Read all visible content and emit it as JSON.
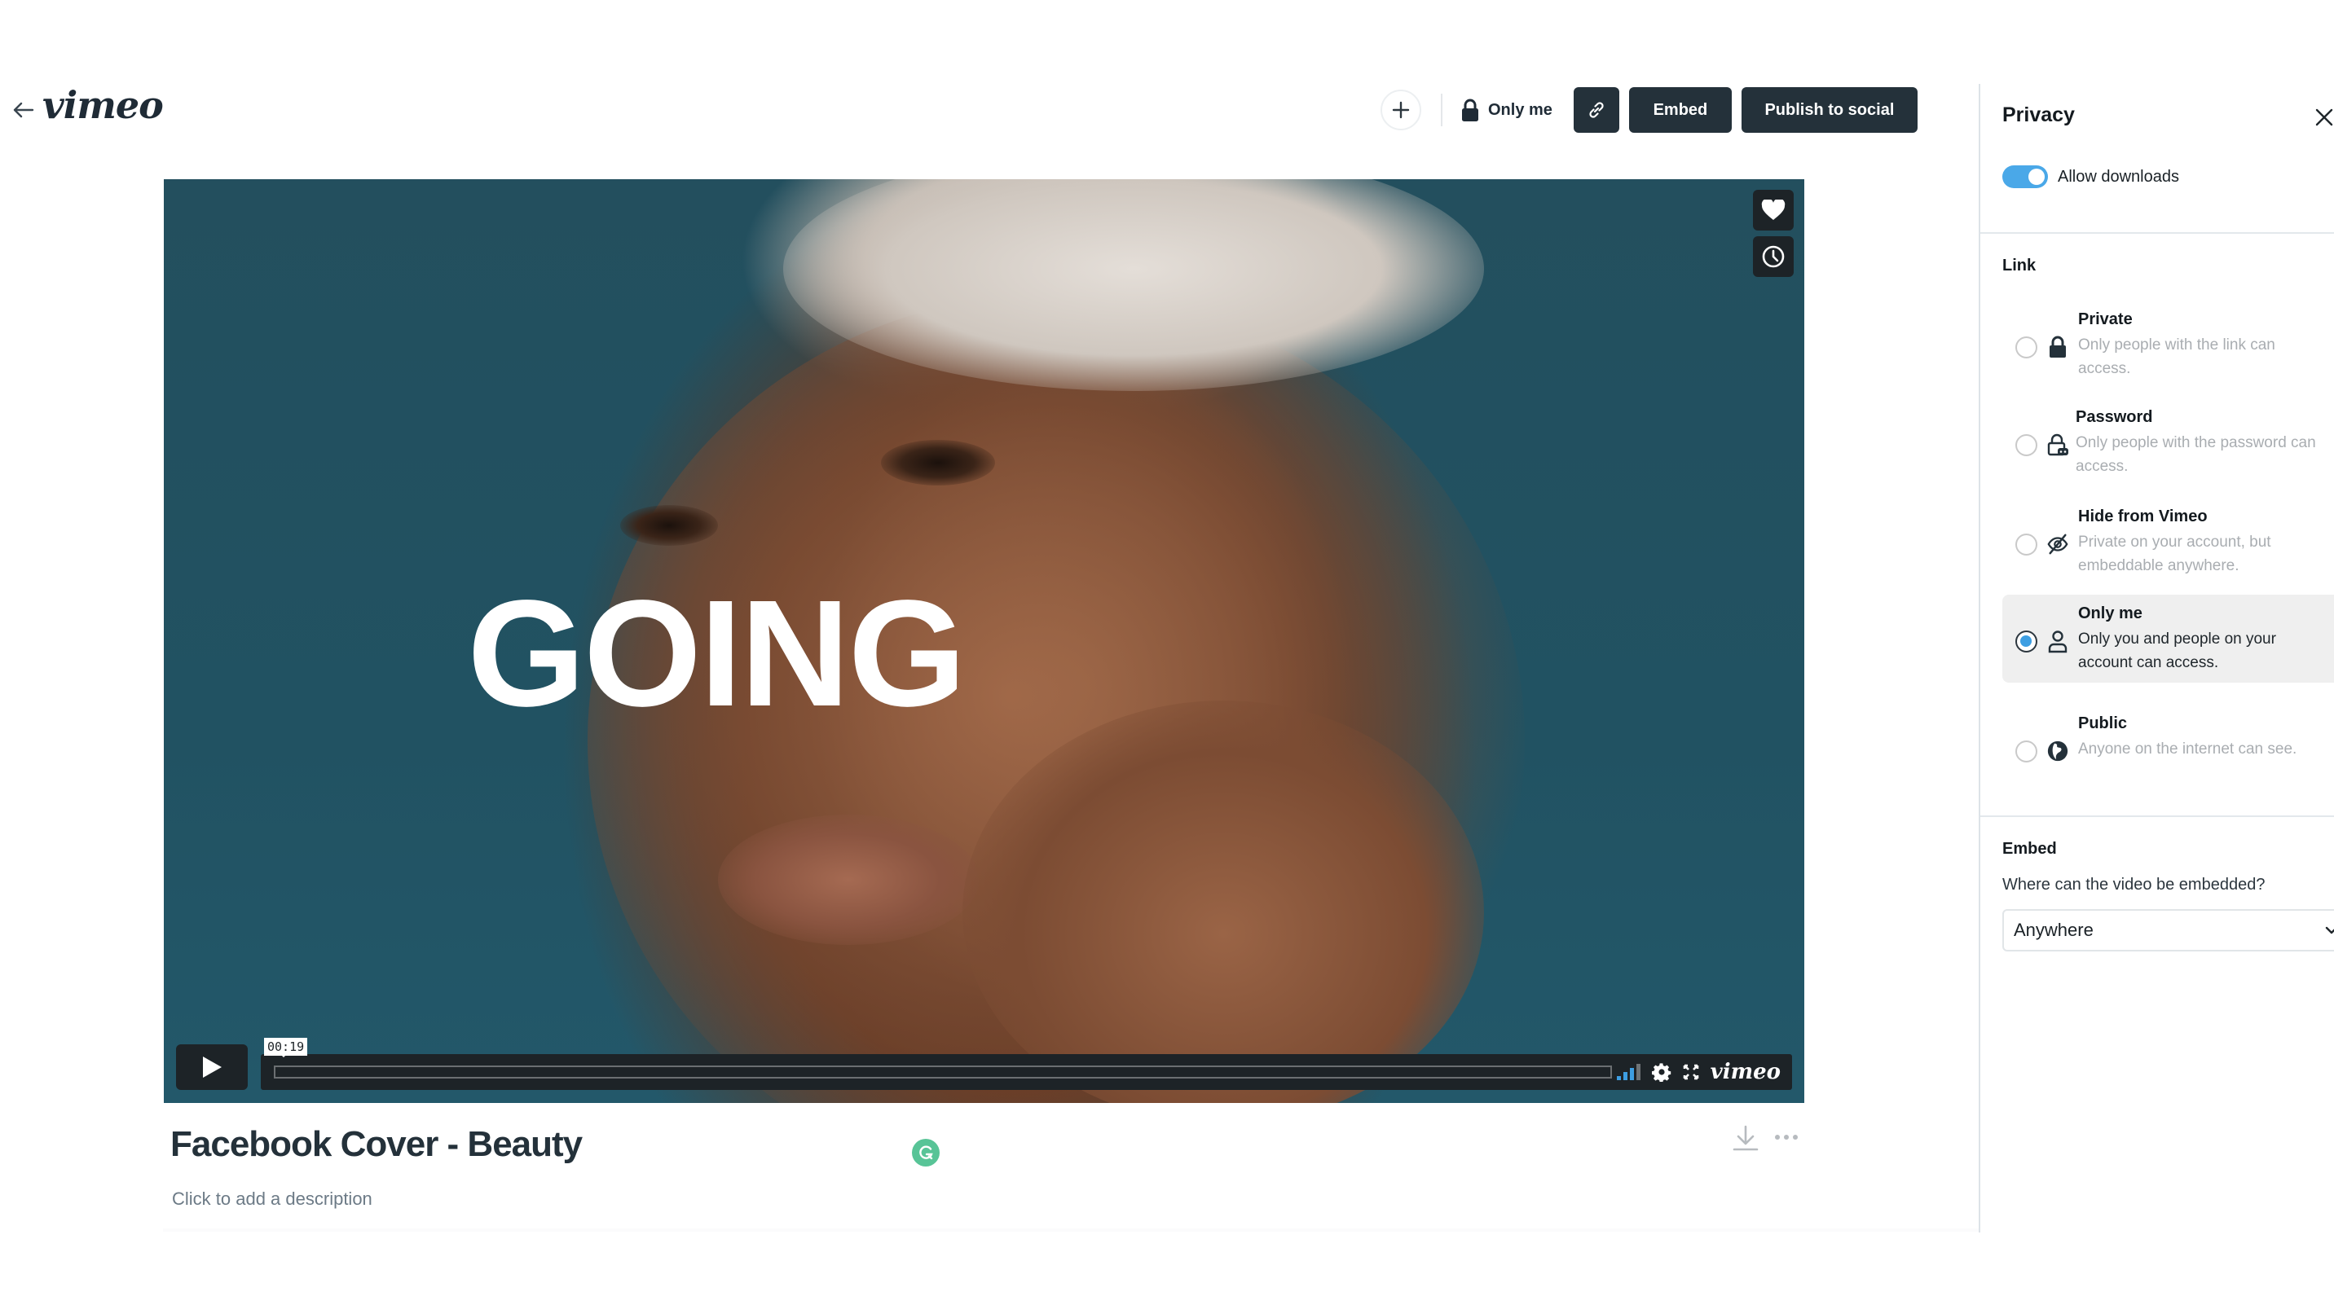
{
  "header": {
    "logo_text": "vimeo",
    "privacy_status": "Only me",
    "embed_label": "Embed",
    "publish_label": "Publish to social"
  },
  "video": {
    "overlay_text": "GOING",
    "current_time": "00:19",
    "player_logo": "vimeo",
    "volume_level_bars": 3,
    "volume_total_bars": 4
  },
  "details": {
    "title": "Facebook Cover - Beauty",
    "description_placeholder": "Click to add a description"
  },
  "panel": {
    "title": "Privacy",
    "allow_downloads_label": "Allow downloads",
    "allow_downloads_on": true,
    "link_section_label": "Link",
    "options": [
      {
        "name": "Private",
        "description": "Only people with the link can access.",
        "icon": "lock-icon",
        "selected": false
      },
      {
        "name": "Password",
        "description": "Only people with the password can access.",
        "icon": "password-lock-icon",
        "selected": false
      },
      {
        "name": "Hide from Vimeo",
        "description": "Private on your account, but embeddable anywhere.",
        "icon": "eye-off-icon",
        "selected": false
      },
      {
        "name": "Only me",
        "description": "Only you and people on your account can access.",
        "icon": "person-icon",
        "selected": true
      },
      {
        "name": "Public",
        "description": "Anyone on the internet can see.",
        "icon": "globe-icon",
        "selected": false
      }
    ],
    "embed_section_label": "Embed",
    "embed_question": "Where can the video be embedded?",
    "embed_selected": "Anywhere"
  },
  "colors": {
    "accent_blue": "#3d9ee2",
    "toggle_blue": "#4aa8e8",
    "dark_button": "#24313a",
    "grammarly_green": "#58c497"
  }
}
